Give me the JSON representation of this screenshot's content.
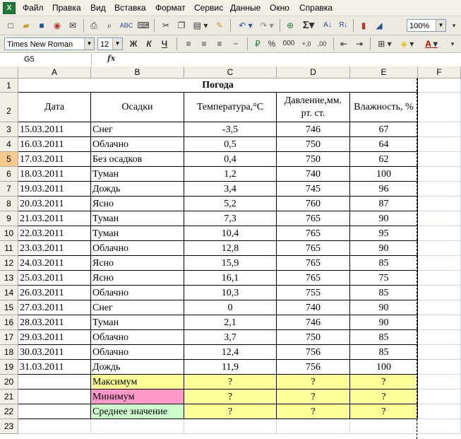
{
  "menu": [
    "Файл",
    "Правка",
    "Вид",
    "Вставка",
    "Формат",
    "Сервис",
    "Данные",
    "Окно",
    "Справка"
  ],
  "toolbar": {
    "zoom": "100%",
    "font_name": "Times New Roman",
    "font_size": "12",
    "bold": "Ж",
    "italic": "К",
    "underline": "Ч",
    "percent": "%",
    "thousands": "000",
    "sum": "Σ"
  },
  "formula_bar": {
    "name_box": "G5",
    "fx": "fx",
    "content": ""
  },
  "columns": [
    "A",
    "B",
    "C",
    "D",
    "E",
    "F"
  ],
  "rows": [
    "1",
    "2",
    "3",
    "4",
    "5",
    "6",
    "7",
    "8",
    "9",
    "10",
    "11",
    "12",
    "13",
    "14",
    "15",
    "16",
    "17",
    "18",
    "19",
    "20",
    "21",
    "22",
    "23"
  ],
  "selected_row": "5",
  "sheet": {
    "title": "Погода",
    "headers": {
      "date": "Дата",
      "precip": "Осадки",
      "temp": "Температура,°С",
      "pressure": "Давление,мм. рт. ст.",
      "humidity": "Влажность, %"
    },
    "data": [
      [
        "15.03.2011",
        "Снег",
        "-3,5",
        "746",
        "67"
      ],
      [
        "16.03.2011",
        "Облачно",
        "0,5",
        "750",
        "64"
      ],
      [
        "17.03.2011",
        "Без осадков",
        "0,4",
        "750",
        "62"
      ],
      [
        "18.03.2011",
        "Туман",
        "1,2",
        "740",
        "100"
      ],
      [
        "19.03.2011",
        "Дождь",
        "3,4",
        "745",
        "96"
      ],
      [
        "20.03.2011",
        "Ясно",
        "5,2",
        "760",
        "87"
      ],
      [
        "21.03.2011",
        "Туман",
        "7,3",
        "765",
        "90"
      ],
      [
        "22.03.2011",
        "Туман",
        "10,4",
        "765",
        "95"
      ],
      [
        "23.03.2011",
        "Облачно",
        "12,8",
        "765",
        "90"
      ],
      [
        "24.03.2011",
        "Ясно",
        "15,9",
        "765",
        "85"
      ],
      [
        "25.03.2011",
        "Ясно",
        "16,1",
        "765",
        "75"
      ],
      [
        "26.03.2011",
        "Облачно",
        "10,3",
        "755",
        "85"
      ],
      [
        "27.03.2011",
        "Снег",
        "0",
        "740",
        "90"
      ],
      [
        "28.03.2011",
        "Туман",
        "2,1",
        "746",
        "90"
      ],
      [
        "29.03.2011",
        "Облачно",
        "3,7",
        "750",
        "85"
      ],
      [
        "30.03.2011",
        "Облачно",
        "12,4",
        "756",
        "85"
      ],
      [
        "31.03.2011",
        "Дождь",
        "11,9",
        "756",
        "100"
      ]
    ],
    "summary": [
      {
        "label": "Максимум",
        "color": "#ffff99",
        "values": [
          "?",
          "?",
          "?"
        ]
      },
      {
        "label": "Минимум",
        "color": "#ff99cc",
        "values": [
          "?",
          "?",
          "?"
        ]
      },
      {
        "label": "Среднее значение",
        "color": "#ccffcc",
        "values": [
          "?",
          "?",
          "?"
        ]
      }
    ]
  }
}
